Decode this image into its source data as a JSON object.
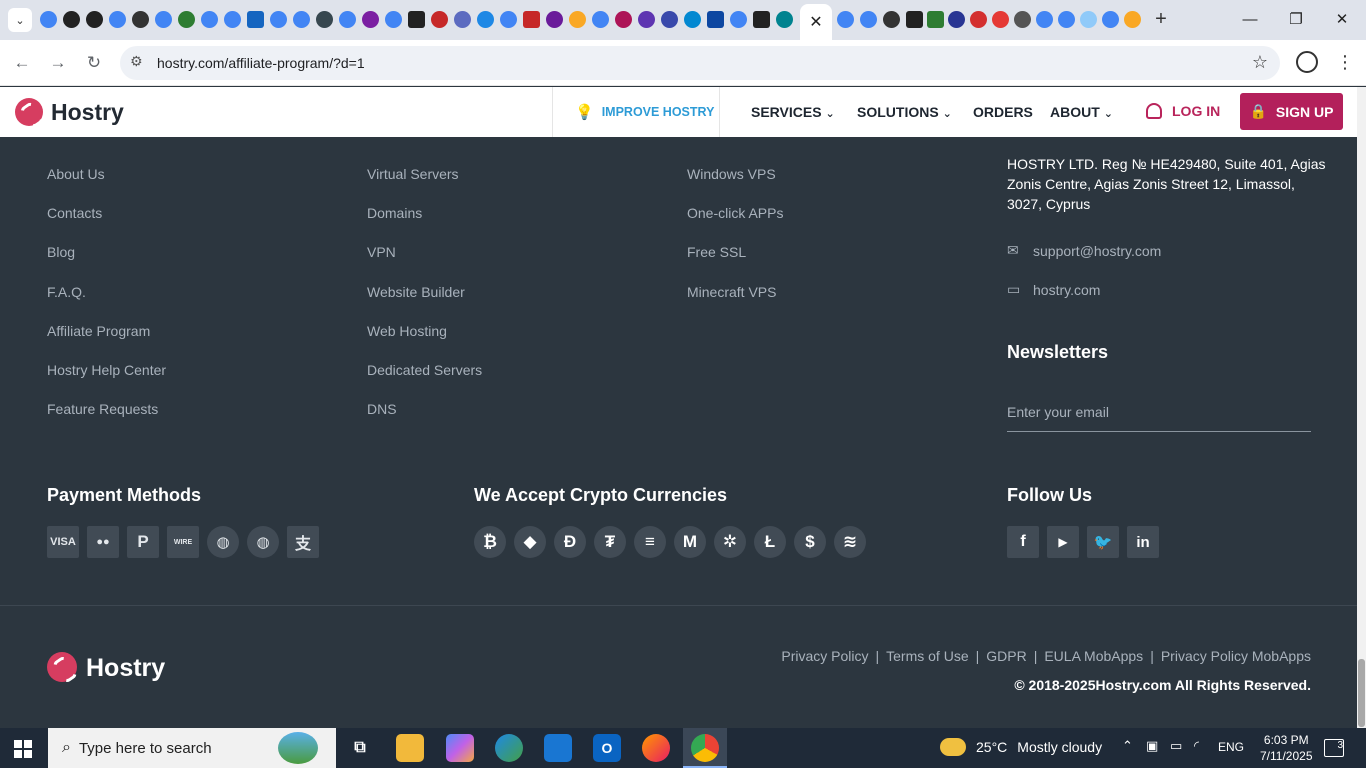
{
  "browser": {
    "url": "hostry.com/affiliate-program/?d=1",
    "close_tab_glyph": "✕",
    "new_tab_glyph": "+"
  },
  "site": {
    "brand": "Hostry",
    "improve": "IMPROVE HOSTRY",
    "nav": [
      "SERVICES",
      "SOLUTIONS",
      "ORDERS",
      "ABOUT"
    ],
    "login": "LOG IN",
    "signup": "SIGN UP"
  },
  "footer": {
    "col1": [
      "About Us",
      "Contacts",
      "Blog",
      "F.A.Q.",
      "Affiliate Program",
      "Hostry Help Center",
      "Feature Requests"
    ],
    "col2": [
      "Virtual Servers",
      "Domains",
      "VPN",
      "Website Builder",
      "Web Hosting",
      "Dedicated Servers",
      "DNS"
    ],
    "col3": [
      "Windows VPS",
      "One-click APPs",
      "Free SSL",
      "Minecraft VPS"
    ],
    "address": "HOSTRY LTD. Reg № HE429480, Suite 401, Agias Zonis Centre, Agias Zonis Street 12, Limassol, 3027, Cyprus",
    "email": "support@hostry.com",
    "website": "hostry.com",
    "newsletters_heading": "Newsletters",
    "email_placeholder": "Enter your email",
    "payment_heading": "Payment Methods",
    "payment_icons": [
      "visa-icon",
      "mastercard-icon",
      "paypal-icon",
      "wire-transfer-icon",
      "webmoney-icon",
      "webmoney-alt-icon",
      "alipay-icon"
    ],
    "visa_label": "VISA",
    "wire_label": "WIRE",
    "crypto_heading": "We Accept Crypto Currencies",
    "crypto_icons": [
      "bitcoin-icon",
      "ethereum-icon",
      "dogecoin-icon",
      "tether-icon",
      "dash-icon",
      "monero-icon",
      "ripple-icon",
      "litecoin-icon",
      "usd-coin-icon",
      "stellar-icon"
    ],
    "follow_heading": "Follow Us",
    "social_icons": [
      "facebook-icon",
      "youtube-icon",
      "twitter-icon",
      "linkedin-icon"
    ],
    "legal_links": [
      "Privacy Policy",
      "Terms of Use",
      "GDPR",
      "EULA MobApps",
      "Privacy Policy MobApps"
    ],
    "copyright": "© 2018-2025Hostry.com All Rights Reserved."
  },
  "taskbar": {
    "search_placeholder": "Type here to search",
    "temperature": "25°C",
    "weather": "Mostly cloudy",
    "language": "ENG",
    "time": "6:03 PM",
    "date": "7/11/2025",
    "notifications": "3"
  },
  "colors": {
    "footer_bg": "#2c363f",
    "brand_magenta": "#b3205b",
    "improve_blue": "#2d9bd6"
  }
}
